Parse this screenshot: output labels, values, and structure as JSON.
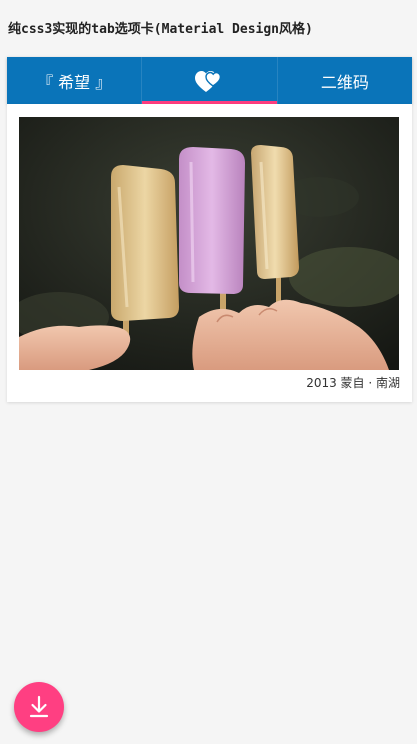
{
  "page": {
    "title": "纯css3实现的tab选项卡(Material Design风格)"
  },
  "tabs": [
    {
      "label": "『 希望 』",
      "icon": null,
      "active": false
    },
    {
      "label": "",
      "icon": "hearts-icon",
      "active": true
    },
    {
      "label": "二维码",
      "icon": null,
      "active": false
    }
  ],
  "card": {
    "image_description": "popsicles-photo",
    "caption": "2013 蒙自 · 南湖"
  },
  "fab": {
    "icon": "download-icon"
  },
  "colors": {
    "tab_bar": "#0a74b9",
    "tab_indicator": "#ff3d7f",
    "fab": "#ff3f82",
    "background": "#f5f5f5"
  }
}
